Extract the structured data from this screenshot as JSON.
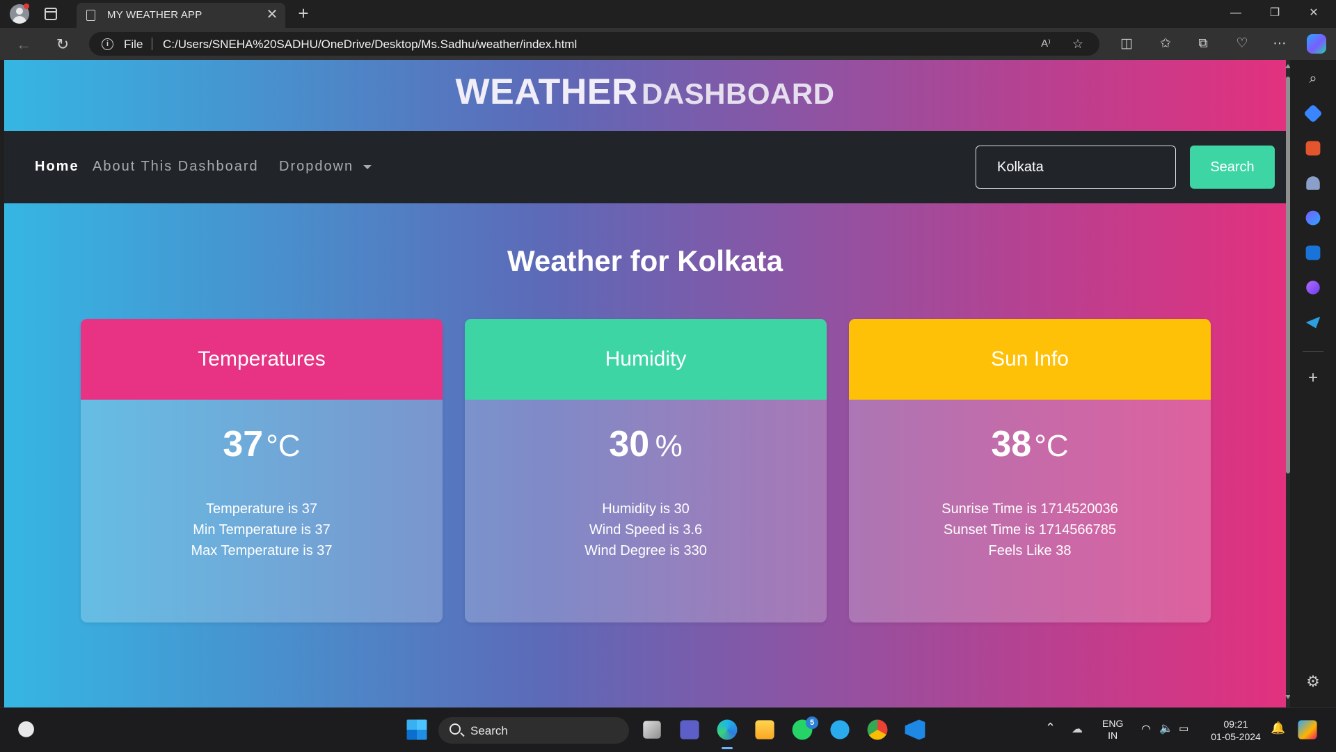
{
  "browser": {
    "tab_title": "MY WEATHER APP",
    "address_prefix": "File",
    "url": "C:/Users/SNEHA%20SADHU/OneDrive/Desktop/Ms.Sadhu/weather/index.html",
    "read_aloud_label": "A⁾"
  },
  "dashboard": {
    "title_big": "WEATHER",
    "title_small": "DASHBOARD",
    "nav": {
      "home": "Home",
      "about": "About This Dashboard",
      "dropdown": "Dropdown"
    },
    "search": {
      "value": "Kolkata",
      "button_label": "Search"
    },
    "heading": "Weather for Kolkata",
    "cards": [
      {
        "header": "Temperatures",
        "header_color": "#e83283",
        "value": "37",
        "unit": "°C",
        "lines": [
          "Temperature is 37",
          "Min Temperature is 37",
          "Max Temperature is 37"
        ]
      },
      {
        "header": "Humidity",
        "header_color": "#3dd5a3",
        "value": "30",
        "unit": "%",
        "lines": [
          "Humidity is 30",
          "Wind Speed is 3.6",
          "Wind Degree is 330"
        ]
      },
      {
        "header": "Sun Info",
        "header_color": "#ffc107",
        "value": "38",
        "unit": "°C",
        "lines": [
          "Sunrise Time is 1714520036",
          "Sunset Time is 1714566785",
          "Feels Like 38"
        ]
      }
    ]
  },
  "taskbar": {
    "search_label": "Search",
    "whatsapp_badge": "5",
    "lang_line1": "ENG",
    "lang_line2": "IN",
    "time": "09:21",
    "date": "01-05-2024"
  },
  "colors": {
    "accent_green": "#3dd5a3",
    "navbar_bg": "#212529"
  }
}
